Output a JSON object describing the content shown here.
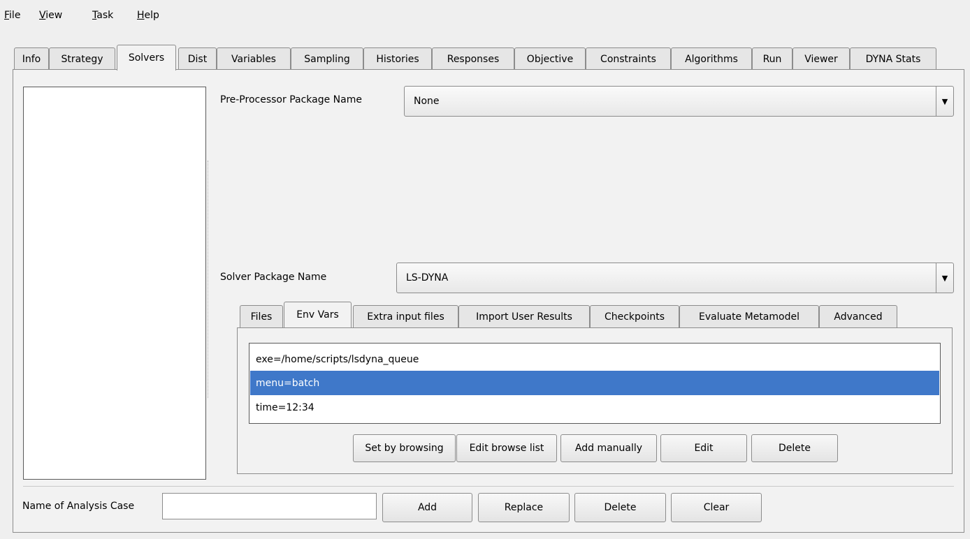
{
  "menu": {
    "file": {
      "mnemonic": "F",
      "rest": "ile"
    },
    "view": {
      "mnemonic": "V",
      "rest": "iew"
    },
    "task": {
      "mnemonic": "T",
      "rest": "ask"
    },
    "help": {
      "mnemonic": "H",
      "rest": "elp"
    }
  },
  "main_tabs": [
    "Info",
    "Strategy",
    "Solvers",
    "Dist",
    "Variables",
    "Sampling",
    "Histories",
    "Responses",
    "Objective",
    "Constraints",
    "Algorithms",
    "Run",
    "Viewer",
    "DYNA Stats"
  ],
  "active_main_tab": "Solvers",
  "preprocessor": {
    "label": "Pre-Processor Package Name",
    "value": "None"
  },
  "solver": {
    "label": "Solver Package Name",
    "value": "LS-DYNA"
  },
  "sub_tabs": [
    "Files",
    "Env Vars",
    "Extra input files",
    "Import User Results",
    "Checkpoints",
    "Evaluate Metamodel",
    "Advanced"
  ],
  "active_sub_tab": "Env Vars",
  "env_vars": [
    {
      "text": "exe=/home/scripts/lsdyna_queue",
      "selected": false
    },
    {
      "text": "menu=batch",
      "selected": true
    },
    {
      "text": "time=12:34",
      "selected": false
    }
  ],
  "env_buttons": {
    "set_by_browsing": "Set by browsing",
    "edit_browse_list": "Edit browse list",
    "add_manually": "Add manually",
    "edit": "Edit",
    "delete": "Delete"
  },
  "analysis_case": {
    "label": "Name of Analysis Case",
    "value": "",
    "add": "Add",
    "replace": "Replace",
    "delete": "Delete",
    "clear": "Clear"
  },
  "colors": {
    "selection": "#3f78c9"
  }
}
